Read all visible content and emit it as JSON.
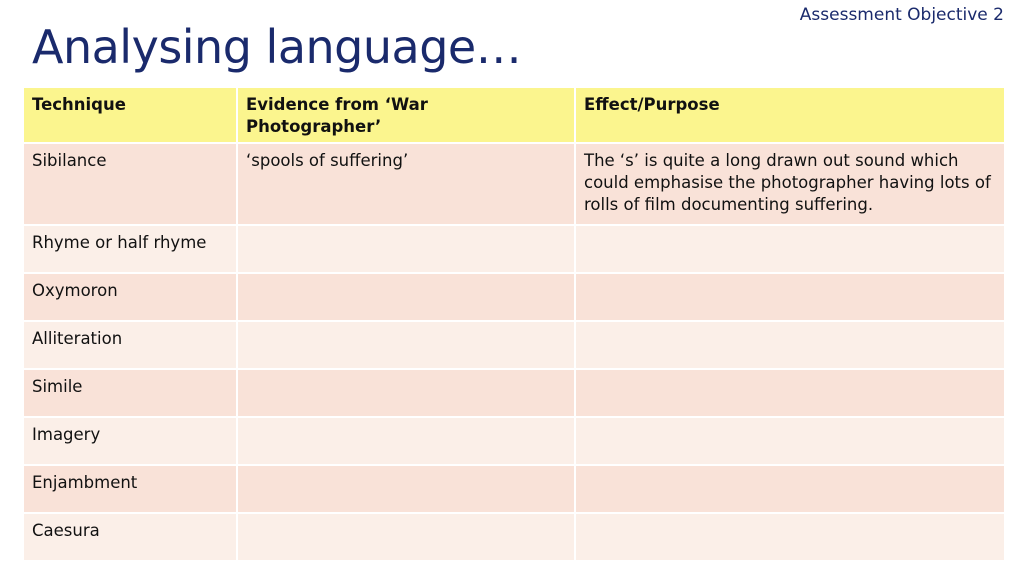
{
  "header": {
    "objective": "Assessment Objective 2",
    "title": "Analysing language…"
  },
  "table": {
    "headers": [
      "Technique",
      "Evidence from ‘War Photographer’",
      "Effect/Purpose"
    ],
    "rows": [
      [
        "Sibilance",
        "‘spools of suffering’",
        "The ‘s’ is quite a long drawn out sound which could emphasise the photographer having lots of rolls of film documenting suffering."
      ],
      [
        "Rhyme or half rhyme",
        "",
        ""
      ],
      [
        "Oxymoron",
        "",
        ""
      ],
      [
        "Alliteration",
        "",
        ""
      ],
      [
        "Simile",
        "",
        ""
      ],
      [
        "Imagery",
        "",
        ""
      ],
      [
        "Enjambment",
        "",
        ""
      ],
      [
        "Caesura",
        "",
        ""
      ]
    ]
  },
  "colors": {
    "header_fill": "#fbf58e",
    "row_fill_dark": "#f9e2d8",
    "row_fill_light": "#fbefe8",
    "title_color": "#1a2a6c"
  }
}
